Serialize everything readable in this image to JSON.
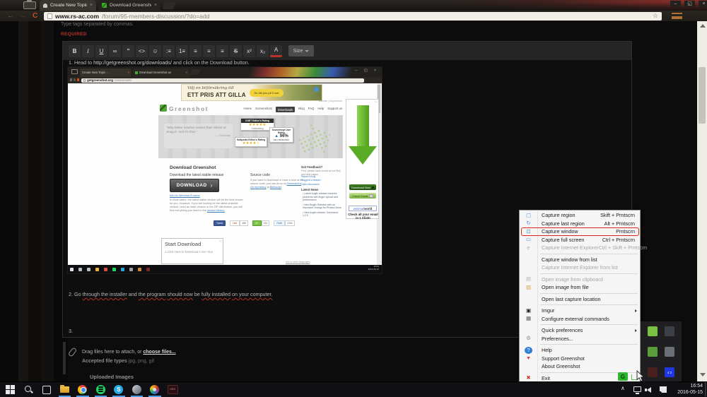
{
  "window": {
    "minimize": "–",
    "restore": "◱",
    "close": "×"
  },
  "browser": {
    "tabs": [
      {
        "label": "Create New Topic - .",
        "close": "×"
      },
      {
        "label": "Download Greenshot and",
        "close": "×"
      }
    ],
    "back": "←",
    "forward": "→",
    "reload": "C",
    "star": "☆",
    "url_host": "www.rs-ac.com",
    "url_path": "/forum/95-members-discussion/?do=add"
  },
  "forum": {
    "tags_hint": "Type tags separated by commas.",
    "required": "REQUIRED",
    "toolbar": {
      "buttons": [
        {
          "glyph": "B",
          "name": "bold-button",
          "b": true
        },
        {
          "glyph": "I",
          "name": "italic-button",
          "i": true
        },
        {
          "glyph": "U",
          "name": "underline-button",
          "u": true
        },
        {
          "glyph": "∞",
          "name": "link-button"
        },
        {
          "glyph": "”",
          "name": "quote-button",
          "b": true
        },
        {
          "glyph": "<>",
          "name": "code-button"
        },
        {
          "glyph": "☺",
          "name": "emoji-button"
        },
        {
          "glyph": ":≡",
          "name": "bullet-list-button"
        },
        {
          "glyph": "1≡",
          "name": "numbered-list-button"
        },
        {
          "glyph": "≡",
          "name": "align-left-button"
        },
        {
          "glyph": "≡",
          "name": "align-center-button"
        },
        {
          "glyph": "≡",
          "name": "align-right-button"
        },
        {
          "glyph": "S",
          "name": "strikethrough-button",
          "strike": true
        },
        {
          "glyph": "x²",
          "name": "superscript-button"
        },
        {
          "glyph": "x₂",
          "name": "subscript-button"
        },
        {
          "glyph": "A",
          "name": "text-color-button",
          "acolor": true
        }
      ],
      "size_label": "Size"
    },
    "editor": {
      "step1": [
        {
          "t": "1. Head to "
        },
        {
          "t": "http://getgreenshot.org/downloads/",
          "sq": true,
          "link": true
        },
        {
          "t": " and click on the "
        },
        {
          "t": "Download",
          "sq": true
        },
        {
          "t": " "
        },
        {
          "t": "button",
          "sq": true
        },
        {
          "t": "."
        }
      ],
      "step2": [
        {
          "t": "2. Go "
        },
        {
          "t": "through the installer",
          "sq": true
        },
        {
          "t": " and "
        },
        {
          "t": "the program",
          "sq": true
        },
        {
          "t": " "
        },
        {
          "t": "should now",
          "sq": true
        },
        {
          "t": " be "
        },
        {
          "t": "fully installed",
          "sq": true
        },
        {
          "t": " "
        },
        {
          "t": "on your computer.",
          "sq": true
        }
      ],
      "step3": "3."
    },
    "attach": {
      "drag_prefix": "Drag files here to attach, or ",
      "choose_link": "choose files...",
      "accepted_bold": "Accepted file types",
      "accepted_types": " jpg, png, gif"
    },
    "uploaded_heading": "Uploaded Images"
  },
  "shot": {
    "tabs": [
      {
        "label": "Create New Topic - .",
        "close": "×"
      },
      {
        "label": "Download Greenshot an",
        "close": "×"
      }
    ],
    "url_host": "getgreenshot.org",
    "url_path": "/downloads/",
    "banner": {
      "line1": "Välj en bilförsäkring till",
      "line2": "ETT PRIS ATT GILLA",
      "button": "Se ditt pris på 5 sek"
    },
    "site": {
      "toplinks": "Sitemap | Impressum",
      "logo": "Greenshot",
      "nav": [
        {
          "label": "Home"
        },
        {
          "label": "Screenshots"
        },
        {
          "label": "Downloads",
          "active": true
        },
        {
          "label": "Blog"
        },
        {
          "label": "FAQ"
        },
        {
          "label": "Help"
        },
        {
          "label": "Support us"
        }
      ],
      "quote": "“Way better intuitive control than Skitch or Snag-it. And it's free.”",
      "quote_author": "— Christian",
      "badge_cnet_title": "CNET Editor's Rating",
      "badge_cnet_stars": "★★★★★",
      "badge_cnet_sub": "Outstanding",
      "badge_softpedia_title": "Softpedia Editor's Rating",
      "badge_softpedia_stars": "★★★★☆",
      "badge_sf_title": "Sourceforge User Rating",
      "badge_sf_thumb": "▲",
      "badge_sf_value": "96%",
      "badge_sf_sub": "RECOMMENDED",
      "download_heading": "Download Greenshot",
      "stable_heading": "Download the latest stable release",
      "download_button": "DOWNLOAD",
      "download_arrow": "›",
      "win8_link": "Info for Windows 8 users!",
      "stable_body": "In most cases, the latest stable version will be the best choice for you. However, if you are looking for the latest unstable version, need an older version or the ZIP distribution, you will find everything you need in the ",
      "version_link": "version history.",
      "source_heading": "Source code",
      "source_body1": "If you want to download or have a look at the source code, you can do so at ",
      "source_link1": "Greenshot's Git repository",
      "source_body2": " at ",
      "source_link2": "BitBucket",
      "source_body3": ".",
      "feedback_heading": "Got Feedback?",
      "feedback_body": "First, please have a look at our FAQ and help pages.",
      "feedback_links": [
        {
          "label": "Report a bug"
        },
        {
          "label": "Suggest a feature"
        },
        {
          "label": "Open discussion"
        }
      ],
      "news_heading": "Latest News",
      "news_items": [
        {
          "text": "Latest bugfix release resolves problems with Imgur upload and performance"
        },
        {
          "text": "New Bugfix Release with an Important Change for Picasa Users"
        },
        {
          "text": "New bugfix release: Greenshot 1.2.5"
        }
      ],
      "social": [
        {
          "label": "Tweet",
          "count": ""
        },
        {
          "label": "Like",
          "count": "486"
        },
        {
          "label": "G+",
          "count": "131"
        },
        {
          "label": "Flattr",
          "count": "1242"
        }
      ],
      "langs_link": "Info in other languages"
    },
    "start_ad": {
      "title": "Start Download",
      "body": "1.Click Here to Download 2.Get Your"
    },
    "arrow_ad": {
      "adchoices": "▷×",
      "btn1": "Download Now",
      "btn2": "Check Email",
      "brand1": "webmail",
      "brand2": "world",
      "tagline": "Check all your email in 1 Click!"
    },
    "taskbar": {
      "icons": [
        {
          "name": "inner-start-icon",
          "color": "#dfe3e8"
        },
        {
          "name": "inner-search-icon",
          "color": "#b9bdc4"
        },
        {
          "name": "inner-taskview-icon",
          "color": "#b9bdc4"
        },
        {
          "name": "inner-explorer-icon",
          "color": "#e8b53a"
        },
        {
          "name": "inner-chrome-icon",
          "color": "#d94f3f"
        },
        {
          "name": "inner-spotify-icon",
          "color": "#1ed760"
        },
        {
          "name": "inner-skype-icon",
          "color": "#29a8e0"
        },
        {
          "name": "inner-app-icon",
          "color": "#9aa0a8"
        },
        {
          "name": "inner-paint-icon",
          "color": "#c98a3a"
        },
        {
          "name": "inner-obs-icon",
          "color": "#7a2a2a"
        }
      ],
      "time": "16:54",
      "date": "2016-05-15"
    }
  },
  "menu": {
    "items": [
      {
        "label": "Capture region",
        "shortcut": "Skift + Prntscrn",
        "icon": "▢",
        "icon_color": "#5b9bd5",
        "dn": "menu-item-capture-region",
        "icon_name": "capture-region-icon"
      },
      {
        "label": "Capture last region",
        "shortcut": "Alt + Prntscrn",
        "icon": "↻",
        "icon_color": "#4a90d9",
        "dn": "menu-item-capture-last-region",
        "icon_name": "capture-last-region-icon"
      },
      {
        "label": "Capture window",
        "shortcut": "Prntscrn",
        "icon": "⊡",
        "icon_color": "#4a90d9",
        "highlighted": true,
        "dn": "menu-item-capture-window",
        "icon_name": "capture-window-icon"
      },
      {
        "label": "Capture full screen",
        "shortcut": "Ctrl + Prntscrn",
        "icon": "▭",
        "icon_color": "#4a90d9",
        "dn": "menu-item-capture-full-screen",
        "icon_name": "capture-fullscreen-icon"
      },
      {
        "label": "Capture Internet Explorer",
        "shortcut": "Ctrl + Skift + Prntscrn",
        "icon": "e",
        "icon_color": "#9ab6d8",
        "disabled": true,
        "dn": "menu-item-capture-internet-explorer",
        "icon_name": "internet-explorer-icon"
      },
      {
        "sep": true
      },
      {
        "label": "Capture window from list",
        "dn": "menu-item-capture-window-from-list"
      },
      {
        "label": "Capture Internet Explorer from list",
        "disabled": true,
        "dn": "menu-item-capture-ie-from-list"
      },
      {
        "sep": true
      },
      {
        "label": "Open image from clipboard",
        "disabled": true,
        "icon": "▤",
        "icon_color": "#b5b5b5",
        "dn": "menu-item-open-image-from-clipboard",
        "icon_name": "clipboard-icon"
      },
      {
        "label": "Open image from file",
        "icon": "▨",
        "icon_color": "#d9a54a",
        "dn": "menu-item-open-image-from-file",
        "icon_name": "open-image-icon"
      },
      {
        "sep": true
      },
      {
        "label": "Open last capture location",
        "dn": "menu-item-open-last-capture-location"
      },
      {
        "sep": true
      },
      {
        "label": "Imgur",
        "submenu": true,
        "icon": "▣",
        "icon_color": "#1b1b1b",
        "dn": "menu-item-imgur",
        "icon_name": "imgur-icon"
      },
      {
        "label": "Configure external commands",
        "icon": "▦",
        "icon_color": "#5a5a5a",
        "dn": "menu-item-configure-external-commands",
        "icon_name": "external-commands-icon"
      },
      {
        "sep": true
      },
      {
        "label": "Quick preferences",
        "submenu": true,
        "dn": "menu-item-quick-preferences"
      },
      {
        "label": "Preferences...",
        "icon": "⚙",
        "icon_color": "#8f8f8f",
        "dn": "menu-item-preferences",
        "icon_name": "gear-icon"
      },
      {
        "sep": true
      },
      {
        "label": "Help",
        "icon": "?",
        "icon_color": "#ffffff",
        "icon_bg": "#2f7fd6",
        "dn": "menu-item-help",
        "icon_name": "help-icon"
      },
      {
        "label": "Support Greenshot",
        "icon": "♥",
        "icon_color": "#e03c31",
        "dn": "menu-item-support-greenshot",
        "icon_name": "heart-icon"
      },
      {
        "label": "About Greenshot",
        "dn": "menu-item-about-greenshot"
      },
      {
        "sep": true
      },
      {
        "label": "Exit",
        "icon": "✖",
        "icon_color": "#cc3a2e",
        "dn": "menu-item-exit",
        "icon_name": "exit-icon"
      }
    ]
  },
  "flyout": {
    "icons": [
      {
        "name": "tray-razer-icon",
        "color": "#7ac043",
        "label": ""
      },
      {
        "name": "tray-display-icon",
        "color": "#3c4148",
        "label": ""
      },
      {
        "name": "tray-geforce-icon",
        "color": "#5a9e3a",
        "label": ""
      },
      {
        "name": "tray-steam-icon",
        "color": "#6b6f76",
        "label": ""
      },
      {
        "name": "tray-recorder-icon",
        "color": "#4a1f1f",
        "label": ""
      },
      {
        "name": "tray-display-ratio-icon",
        "color": "#2136e0",
        "label": "4:3"
      }
    ]
  },
  "taskbar": {
    "apps": [
      {
        "name": "start-button",
        "type": "start"
      },
      {
        "name": "search-button",
        "type": "search"
      },
      {
        "name": "task-view-button",
        "type": "taskview"
      },
      {
        "name": "file-explorer-button",
        "type": "explorer",
        "open": true
      },
      {
        "name": "chrome-button",
        "type": "chrome",
        "open": true
      },
      {
        "name": "spotify-button",
        "type": "spotify",
        "open": true
      },
      {
        "name": "skype-button",
        "type": "skype",
        "open": true,
        "letter": "S"
      },
      {
        "name": "steam-button",
        "type": "steam",
        "open": true
      },
      {
        "name": "paint-button",
        "type": "paint",
        "open": true
      },
      {
        "name": "obs-button",
        "type": "obs",
        "letter": "OBS"
      }
    ],
    "chevron": "∧",
    "time": "16:54",
    "date": "2016-05-15"
  }
}
